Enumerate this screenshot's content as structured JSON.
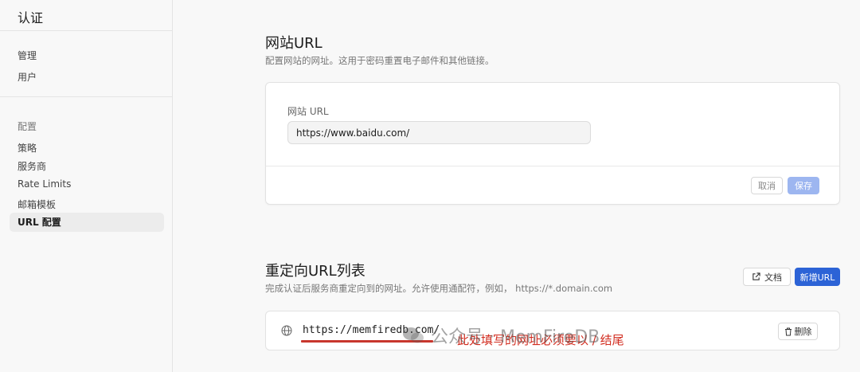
{
  "sidebar": {
    "title": "认证",
    "manage": [
      "管理",
      "用户"
    ],
    "config_heading": "配置",
    "config_items": [
      "策略",
      "服务商",
      "Rate Limits",
      "邮箱模板",
      "URL 配置"
    ]
  },
  "site_url": {
    "title": "网站URL",
    "description": "配置网站的网址。这用于密码重置电子邮件和其他链接。",
    "field_label": "网站 URL",
    "field_value": "https://www.baidu.com/",
    "cancel_label": "取消",
    "save_label": "保存"
  },
  "redirect": {
    "title": "重定向URL列表",
    "description": "完成认证后服务商重定向到的网址。允许使用通配符，例如， https://*.domain.com",
    "docs_label": "文档",
    "add_label": "新增URL",
    "items": [
      {
        "url": "https://memfiredb.com/",
        "delete_label": "删除"
      }
    ],
    "annotation": "此处填写的网址必须要以 / 结尾"
  },
  "watermark": "公众号 · MemFireDB",
  "colors": {
    "primary": "#2c63d6",
    "save_disabled": "#9db6f0",
    "annotation": "#d22d20"
  },
  "icons": [
    "globe-icon",
    "external-link-icon",
    "trash-icon",
    "wechat-logo-icon"
  ]
}
